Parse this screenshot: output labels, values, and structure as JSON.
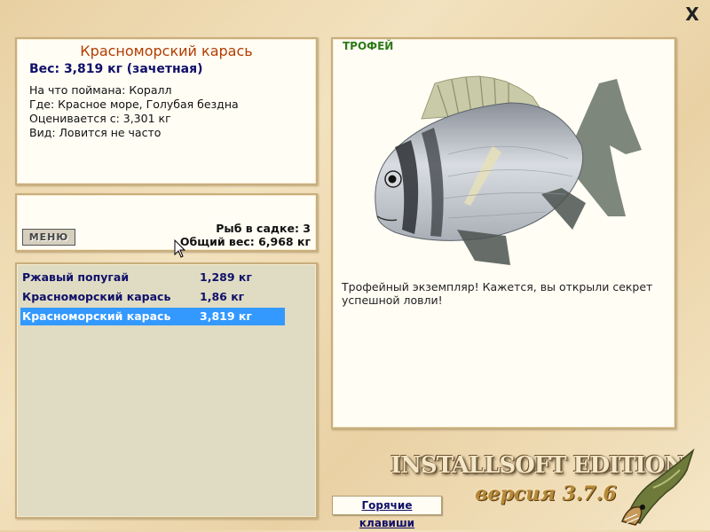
{
  "window": {
    "close_label": "X"
  },
  "info": {
    "title": "Красноморский карась",
    "weight": "Вес: 3,819 кг (зачетная)",
    "lines": [
      "На что поймана: Коралл",
      "Где: Красное море, Голубая бездна",
      "Оценивается с: 3,301 кг",
      "Вид: Ловится не часто"
    ]
  },
  "cage": {
    "menu_label": "МЕНЮ",
    "fish_count": "Рыб в садке: 3",
    "total_weight": "Общий вес: 6,968 кг"
  },
  "catch_list": [
    {
      "name": "Ржавый попугай",
      "weight": "1,289 кг",
      "selected": false
    },
    {
      "name": "Красноморский карась",
      "weight": "1,86 кг",
      "selected": false
    },
    {
      "name": "Красноморский карась",
      "weight": "3,819 кг",
      "selected": true
    }
  ],
  "photo": {
    "badge": "ТРОФЕЙ",
    "description": "Трофейный экземпляр! Кажется, вы открыли секрет успешной ловли!"
  },
  "footer": {
    "brand": "INSTALLSOFT EDITION",
    "version": "версия 3.7.6",
    "hotkeys_label": "Горячие клавиши"
  },
  "colors": {
    "title": "#b33c00",
    "list_text": "#10106a",
    "selection": "#3399ff",
    "trophy": "#2f7a1a"
  }
}
